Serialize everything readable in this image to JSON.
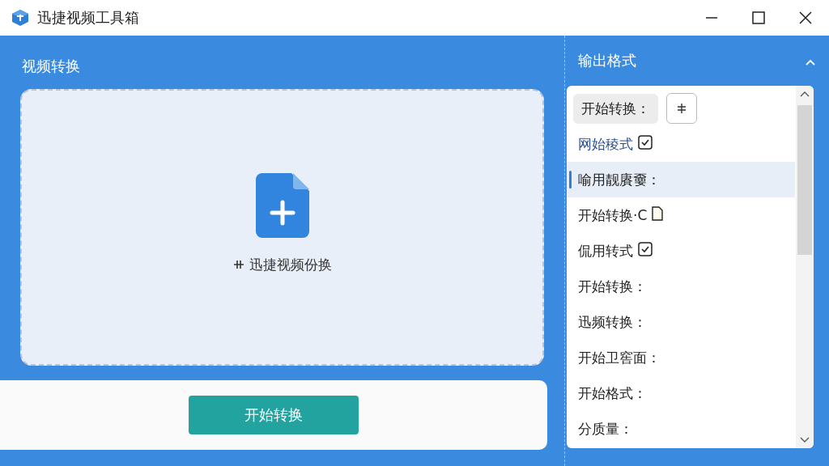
{
  "window": {
    "title": "迅捷视频工具箱"
  },
  "left": {
    "heading": "视频转换",
    "drop_label": "迅捷视频份换",
    "start_button": "开始转换"
  },
  "output": {
    "heading": "输出格式",
    "expanded": true,
    "items": [
      {
        "kind": "chip",
        "label": "开始转换：",
        "selected": false
      },
      {
        "kind": "check",
        "label": "网始稜式",
        "checked": true,
        "link": true,
        "selected": false
      },
      {
        "kind": "plain",
        "label": "喻用靓賡嫑：",
        "selected": true
      },
      {
        "kind": "doc",
        "label": "开始转换·C",
        "selected": false
      },
      {
        "kind": "check",
        "label": "侃用转式",
        "checked": true,
        "link": false,
        "selected": false
      },
      {
        "kind": "plain",
        "label": "开始转换：",
        "selected": false
      },
      {
        "kind": "plain",
        "label": "迅频转换：",
        "selected": false
      },
      {
        "kind": "plain",
        "label": "开始卫窖面：",
        "selected": false
      },
      {
        "kind": "plain",
        "label": "开始格式：",
        "selected": false
      },
      {
        "kind": "plain",
        "label": "分质量：",
        "selected": false
      }
    ]
  }
}
